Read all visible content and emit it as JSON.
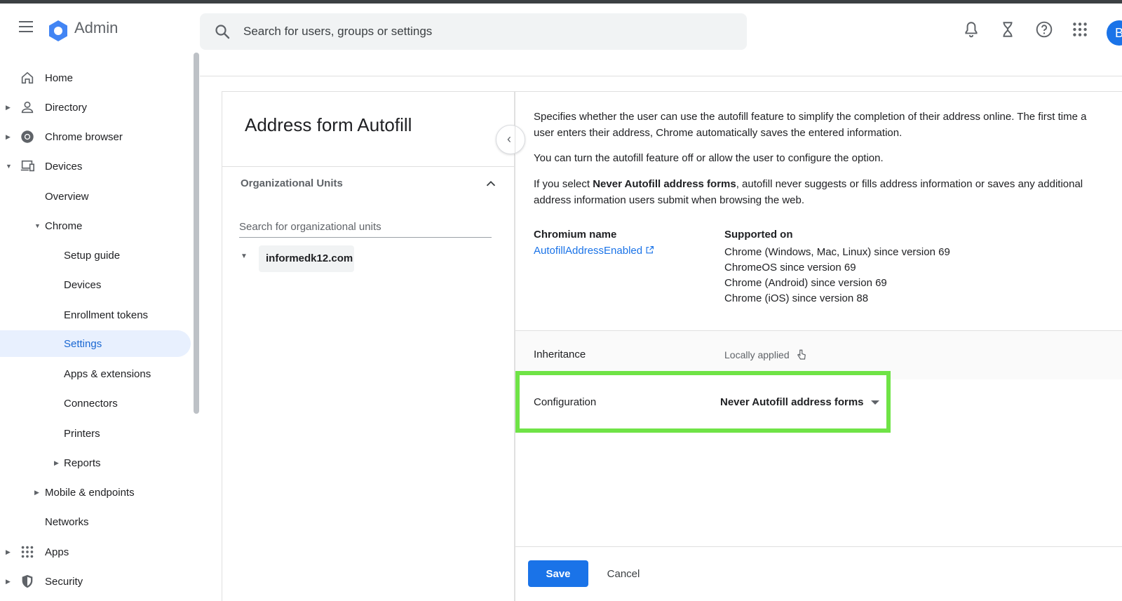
{
  "app": {
    "name": "Admin"
  },
  "search": {
    "placeholder": "Search for users, groups or settings"
  },
  "user": {
    "initial": "B"
  },
  "sidebar": {
    "home": "Home",
    "directory": "Directory",
    "chrome_browser": "Chrome browser",
    "devices": "Devices",
    "overview": "Overview",
    "chrome": "Chrome",
    "setup_guide": "Setup guide",
    "chrome_devices": "Devices",
    "enrollment_tokens": "Enrollment tokens",
    "settings": "Settings",
    "apps_extensions": "Apps & extensions",
    "connectors": "Connectors",
    "printers": "Printers",
    "reports": "Reports",
    "mobile_endpoints": "Mobile & endpoints",
    "networks": "Networks",
    "apps": "Apps",
    "security": "Security"
  },
  "policy": {
    "title": "Address form Autofill",
    "ou_header": "Organizational Units",
    "ou_search_placeholder": "Search for organizational units",
    "ou_root": "informedk12.com",
    "desc1": "Specifies whether the user can use the autofill feature to simplify the completion of their address online. The first time a user enters their address, Chrome automatically saves the entered information.",
    "desc2": "You can turn the autofill feature off or allow the user to configure the option.",
    "desc3_prefix": "If you select ",
    "desc3_bold": "Never Autofill address forms",
    "desc3_suffix": ", autofill never suggests or fills address information or saves any additional address information users submit when browsing the web.",
    "chromium_name_label": "Chromium name",
    "chromium_name_link": "AutofillAddressEnabled",
    "supported_on_label": "Supported on",
    "supported_on": [
      "Chrome (Windows, Mac, Linux) since version 69",
      "ChromeOS since version 69",
      "Chrome (Android) since version 69",
      "Chrome (iOS) since version 88"
    ],
    "inheritance_label": "Inheritance",
    "inheritance_value": "Locally applied",
    "configuration_label": "Configuration",
    "configuration_value": "Never Autofill address forms"
  },
  "actions": {
    "save": "Save",
    "cancel": "Cancel"
  },
  "colors": {
    "accent": "#1a73e8",
    "highlight": "#6fe346"
  }
}
